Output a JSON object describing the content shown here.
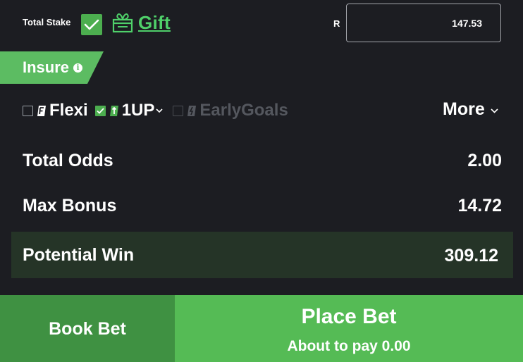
{
  "stake": {
    "label": "Total Stake",
    "confirmed": true,
    "gift_label": "Gift",
    "currency": "R",
    "amount": "147.53"
  },
  "insure": {
    "label": "Insure",
    "info_glyph": "i"
  },
  "options": [
    {
      "key": "flexi",
      "label": "Flexi",
      "checked": false,
      "enabled": true
    },
    {
      "key": "oneup",
      "label": "1UP",
      "checked": true,
      "enabled": true
    },
    {
      "key": "earlygoals",
      "label": "EarlyGoals",
      "checked": false,
      "enabled": false
    }
  ],
  "more_label": "More",
  "summary": {
    "total_odds_label": "Total Odds",
    "total_odds_value": "2.00",
    "max_bonus_label": "Max Bonus",
    "max_bonus_value": "14.72",
    "potential_win_label": "Potential Win",
    "potential_win_value": "309.12"
  },
  "actions": {
    "book_bet_label": "Book Bet",
    "place_bet_label": "Place Bet",
    "pay_text": "About to pay 0.00"
  },
  "colors": {
    "background": "#1c1d22",
    "accent_green": "#55bb55",
    "gift_green": "#4fd06a",
    "book_green": "#3f9142",
    "potential_bg": "#253427"
  }
}
